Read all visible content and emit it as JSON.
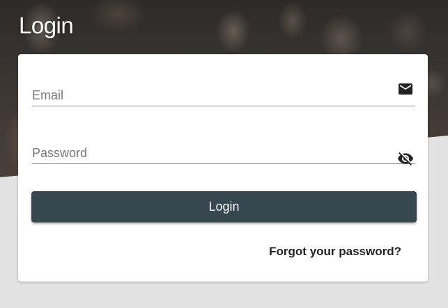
{
  "page": {
    "title": "Login"
  },
  "form": {
    "email": {
      "placeholder": "Email",
      "value": "",
      "icon": "envelope-icon"
    },
    "password": {
      "placeholder": "Password",
      "value": "",
      "icon": "eye-off-icon"
    },
    "login_label": "Login",
    "forgot_label": "Forgot your password?"
  },
  "colors": {
    "button_bg": "#37474f",
    "page_bg": "#e2e2e2",
    "card_bg": "#ffffff"
  }
}
